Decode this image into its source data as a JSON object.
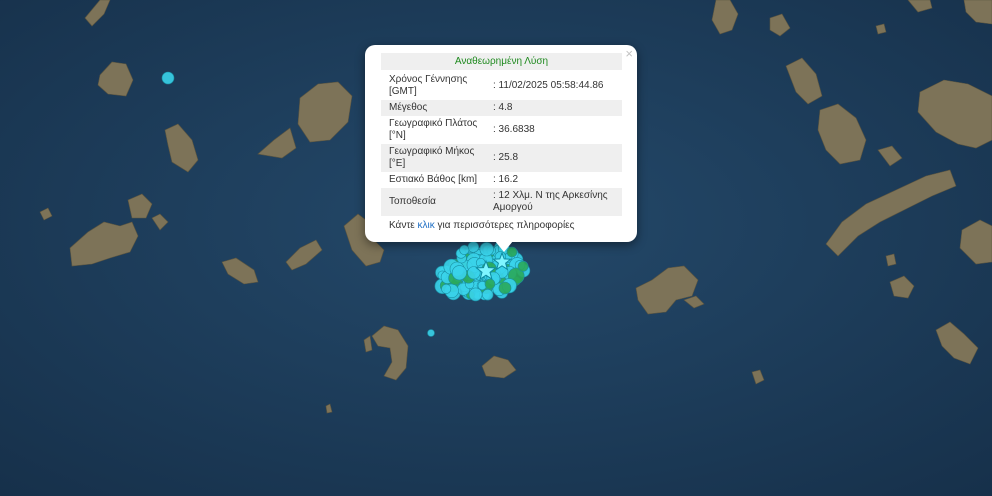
{
  "popup": {
    "title": "Αναθεωρημένη Λύση",
    "close_symbol": "×",
    "rows": [
      {
        "label": "Χρόνος Γέννησης [GMT]",
        "value": ": 11/02/2025 05:58:44.86"
      },
      {
        "label": "Μέγεθος",
        "value": ": 4.8"
      },
      {
        "label": "Γεωγραφικό Πλάτος [°N]",
        "value": ": 36.6838"
      },
      {
        "label": "Γεωγραφικό Μήκος [°E]",
        "value": ": 25.8"
      },
      {
        "label": "Εστιακό Βάθος [km]",
        "value": ": 16.2"
      },
      {
        "label": "Τοποθεσία",
        "value": ": 12 Χλμ. N της Αρκεσίνης Αμοργού"
      }
    ],
    "more_prefix": "Κάντε ",
    "more_link": "κλικ",
    "more_suffix": " για περισσότερες πληροφορίες"
  },
  "map": {
    "sea_color": "#1d3a55",
    "land_color": "#7d7358",
    "marker_cyan": "#3ad3ea",
    "marker_green": "#2aa85a",
    "star_color": "#7ef5ff"
  }
}
